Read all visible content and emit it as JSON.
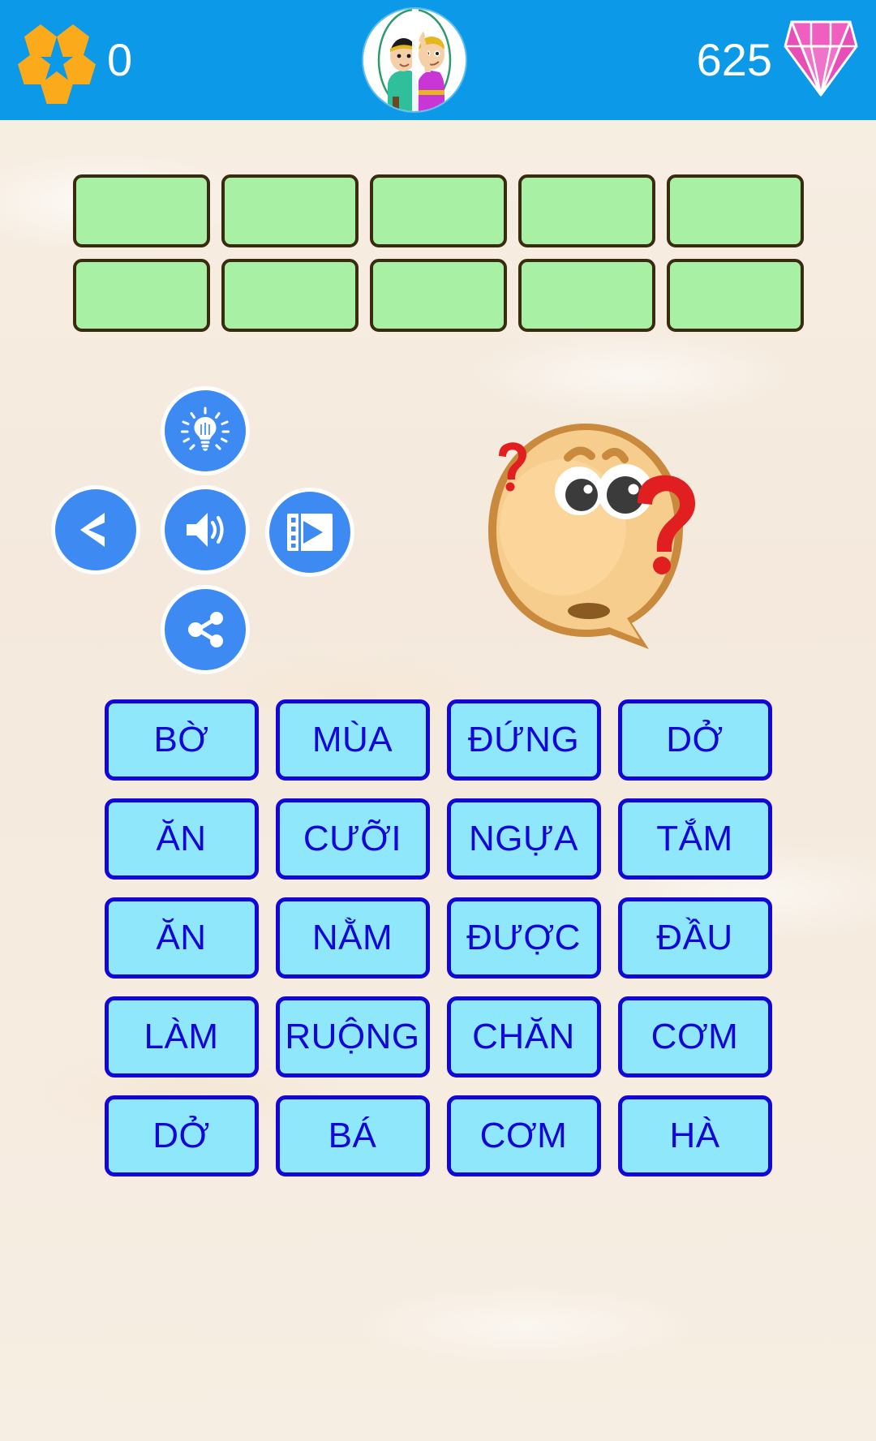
{
  "topbar": {
    "flower_icon": "flower-petals-icon",
    "score": "0",
    "avatar_icon": "two-characters-avatar",
    "gems": "625",
    "gem_icon": "diamond-icon",
    "background_color": "#0c9ae8"
  },
  "answer": {
    "rows": [
      [
        "",
        "",
        "",
        "",
        ""
      ],
      [
        "",
        "",
        "",
        "",
        ""
      ]
    ],
    "slot_fill_color": "#a8f0a4",
    "slot_border_color": "#3a2a10"
  },
  "controls": {
    "hint": {
      "label": "hint-lightbulb-icon"
    },
    "back": {
      "label": "back-arrow-icon"
    },
    "sound": {
      "label": "speaker-icon"
    },
    "video": {
      "label": "video-film-icon"
    },
    "share": {
      "label": "share-icon"
    },
    "button_color": "#3d8bf2"
  },
  "clue": {
    "icon": "thinking-face-speech-bubble",
    "question_marks": 2
  },
  "tiles": {
    "fill_color": "#8ee7fb",
    "border_color": "#1306d6",
    "rows": [
      [
        "BỜ",
        "MÙA",
        "ĐỨNG",
        "DỞ"
      ],
      [
        "ĂN",
        "CƯỠI",
        "NGỰA",
        "TẮM"
      ],
      [
        "ĂN",
        "NẰM",
        "ĐƯỢC",
        "ĐẦU"
      ],
      [
        "LÀM",
        "RUỘNG",
        "CHĂN",
        "CƠM"
      ],
      [
        "DỞ",
        "BÁ",
        "CƠM",
        "HÀ"
      ]
    ]
  }
}
